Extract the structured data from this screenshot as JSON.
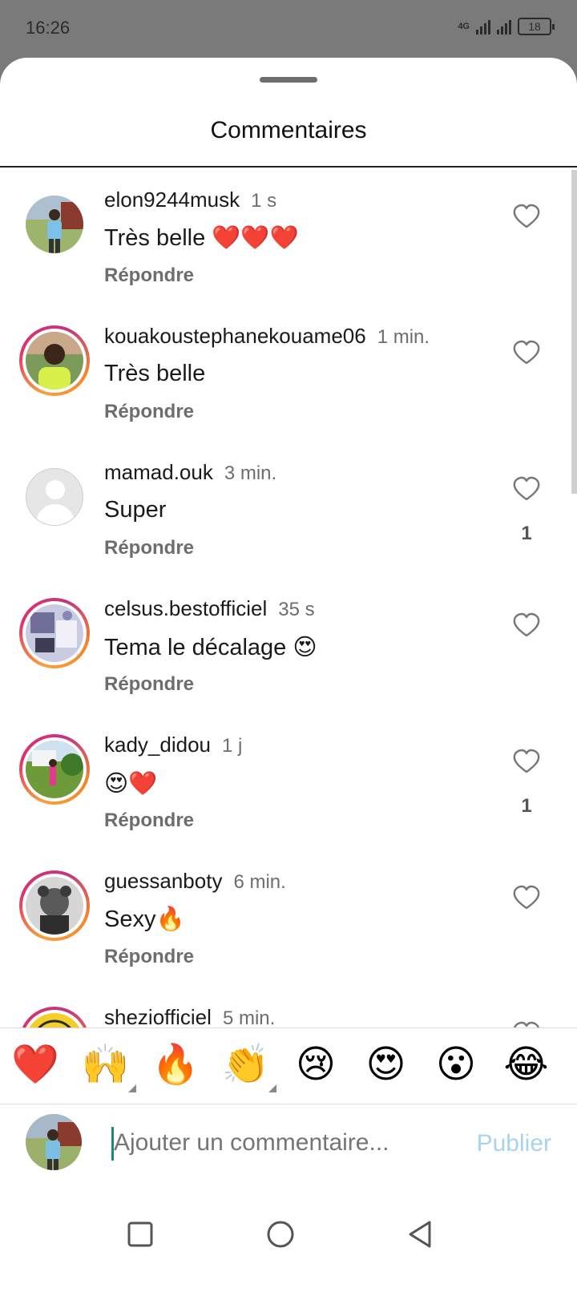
{
  "status": {
    "time": "16:26",
    "network": "4G",
    "battery": "18"
  },
  "sheet": {
    "title": "Commentaires"
  },
  "comments": [
    {
      "user": "elon9244musk",
      "time": "1 s",
      "text": "Très belle ❤️❤️❤️",
      "reply": "Répondre",
      "likes": "",
      "avatar": "photo-man-blue"
    },
    {
      "user": "kouakoustephanekouame06",
      "time": "1 min.",
      "text": "Très belle",
      "reply": "Répondre",
      "likes": "",
      "avatar": "photo-man-yellow"
    },
    {
      "user": "mamad.ouk",
      "time": "3 min.",
      "text": "Super",
      "reply": "Répondre",
      "likes": "1",
      "avatar": "default"
    },
    {
      "user": "celsus.bestofficiel",
      "time": "35 s",
      "text": "Tema le décalage 😍",
      "reply": "Répondre",
      "likes": "",
      "avatar": "photo-room"
    },
    {
      "user": "kady_didou",
      "time": "1 j",
      "text": "😍❤️",
      "reply": "Répondre",
      "likes": "1",
      "avatar": "photo-garden"
    },
    {
      "user": "guessanboty",
      "time": "6 min.",
      "text": "Sexy🔥",
      "reply": "Répondre",
      "likes": "",
      "avatar": "photo-bw"
    },
    {
      "user": "sheziofficiel",
      "time": "5 min.",
      "text": "",
      "reply": "",
      "likes": "",
      "avatar": "logo-yellow"
    }
  ],
  "emoji_bar": [
    "❤️",
    "🙌",
    "🔥",
    "👏",
    "😢",
    "😍",
    "😮",
    "😂"
  ],
  "compose": {
    "placeholder": "Ajouter un commentaire...",
    "publish": "Publier"
  },
  "icons": {
    "like": "heart-outline-icon",
    "nav": [
      "recent-apps-icon",
      "home-icon",
      "back-icon"
    ]
  }
}
